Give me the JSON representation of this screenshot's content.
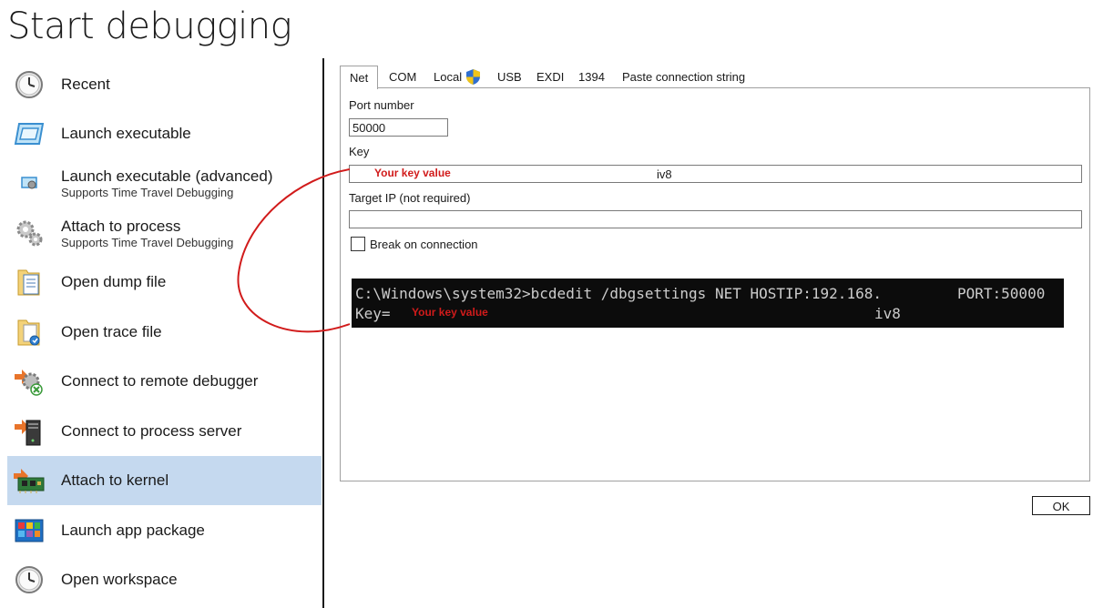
{
  "page": {
    "title": "Start debugging"
  },
  "sidebar": {
    "items": [
      {
        "label": "Recent",
        "sub": "",
        "icon": "clock-icon"
      },
      {
        "label": "Launch executable",
        "sub": "",
        "icon": "window-icon"
      },
      {
        "label": "Launch executable (advanced)",
        "sub": "Supports Time Travel Debugging",
        "icon": "window-gear-icon"
      },
      {
        "label": "Attach to process",
        "sub": "Supports Time Travel Debugging",
        "icon": "gears-icon"
      },
      {
        "label": "Open dump file",
        "sub": "",
        "icon": "document-folder-icon"
      },
      {
        "label": "Open trace file",
        "sub": "",
        "icon": "trace-folder-icon"
      },
      {
        "label": "Connect to remote debugger",
        "sub": "",
        "icon": "remote-gear-icon"
      },
      {
        "label": "Connect to process server",
        "sub": "",
        "icon": "server-icon"
      },
      {
        "label": "Attach to kernel",
        "sub": "",
        "icon": "circuit-board-icon",
        "selected": true
      },
      {
        "label": "Launch app package",
        "sub": "",
        "icon": "app-grid-icon"
      },
      {
        "label": "Open workspace",
        "sub": "",
        "icon": "clock-icon"
      }
    ]
  },
  "tabs": [
    "Net",
    "COM",
    "Local",
    "USB",
    "EXDI",
    "1394",
    "Paste connection string"
  ],
  "active_tab": "Net",
  "form": {
    "port_label": "Port number",
    "port_value": "50000",
    "key_label": "Key",
    "key_value_visible": "iv8",
    "target_ip_label": "Target IP (not required)",
    "target_ip_value": "",
    "break_label": "Break on connection",
    "break_checked": false
  },
  "annotation": {
    "key_note": "Your key value",
    "color": "#d11b1b"
  },
  "terminal": {
    "line1": "C:\\Windows\\system32>bcdedit /dbgsettings NET HOSTIP:192.168.",
    "line1_port": "PORT:50000",
    "line2_prefix": "Key=",
    "line2_suffix": "iv8",
    "key_note": "Your key value"
  },
  "buttons": {
    "ok": "OK"
  }
}
